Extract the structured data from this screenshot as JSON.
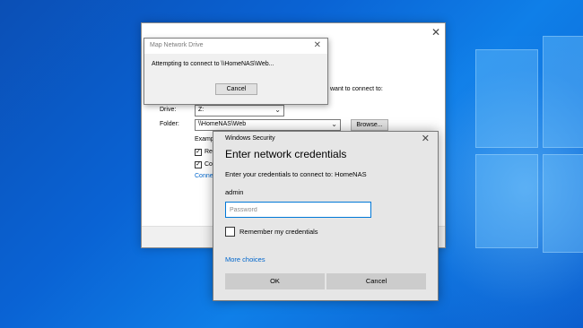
{
  "map_network_drive": {
    "instruction_partial": "want to connect to:",
    "drive_label": "Drive:",
    "drive_value": "Z:",
    "folder_label": "Folder:",
    "folder_value": "\\\\HomeNAS\\Web",
    "browse_label": "Browse...",
    "example_partial": "Exampl",
    "checkbox1_partial": "Rec",
    "checkbox2_partial": "Con",
    "link_partial": "Conne"
  },
  "connecting_dialog": {
    "title": "Map Network Drive",
    "message": "Attempting to connect to \\\\HomeNAS\\Web...",
    "cancel_label": "Cancel"
  },
  "security_dialog": {
    "title": "Windows Security",
    "heading": "Enter network credentials",
    "subtext": "Enter your credentials to connect to: HomeNAS",
    "username": "admin",
    "password_placeholder": "Password",
    "remember_label": "Remember my credentials",
    "more_choices": "More choices",
    "ok_label": "OK",
    "cancel_label": "Cancel"
  },
  "icons": {
    "close": "close-icon",
    "chevron": "chevron-down-icon",
    "check": "checkmark-icon"
  }
}
